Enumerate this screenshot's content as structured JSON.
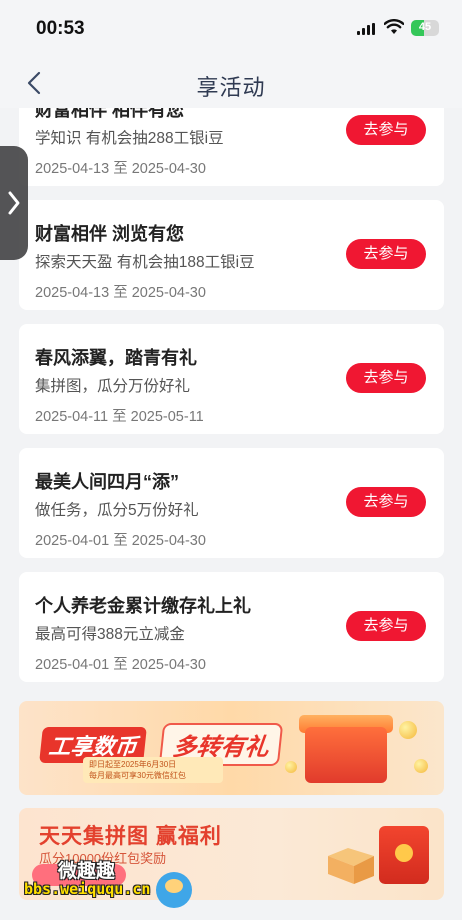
{
  "status_bar": {
    "time": "00:53",
    "battery": "45",
    "battery_level": 0.45
  },
  "nav": {
    "title": "享活动"
  },
  "top_card": {
    "title": "财富相伴 相伴有您",
    "desc": "学知识 有机会抽288工银i豆",
    "date": "2025-04-13 至 2025-04-30",
    "button": "去参与"
  },
  "activities": [
    {
      "title": "财富相伴 浏览有您",
      "desc": "探索天天盈 有机会抽188工银i豆",
      "date": "2025-04-13 至 2025-04-30",
      "button": "去参与"
    },
    {
      "title": "春风添翼，踏青有礼",
      "desc": "集拼图，瓜分万份好礼",
      "date": "2025-04-11 至 2025-05-11",
      "button": "去参与"
    },
    {
      "title": "最美人间四月“添”",
      "desc": "做任务，瓜分5万份好礼",
      "date": "2025-04-01 至 2025-04-30",
      "button": "去参与"
    },
    {
      "title": "个人养老金累计缴存礼上礼",
      "desc": "最高可得388元立减金",
      "date": "2025-04-01 至 2025-04-30",
      "button": "去参与"
    }
  ],
  "banner1": {
    "title_a": "工享数币",
    "title_b": "多转有礼",
    "sub_a": "即日起至2025年6月30日",
    "sub_b": "每月最高可享30元微信红包"
  },
  "banner2": {
    "title": "天天集拼图 赢福利",
    "sub": "瓜分10000份红包奖励"
  },
  "watermark": {
    "cn": "微趣趣",
    "url": "bbs.weiququ.cn"
  },
  "colors": {
    "accent": "#f01732",
    "nav_title": "#2f3a52",
    "background": "#f2f3f5"
  }
}
